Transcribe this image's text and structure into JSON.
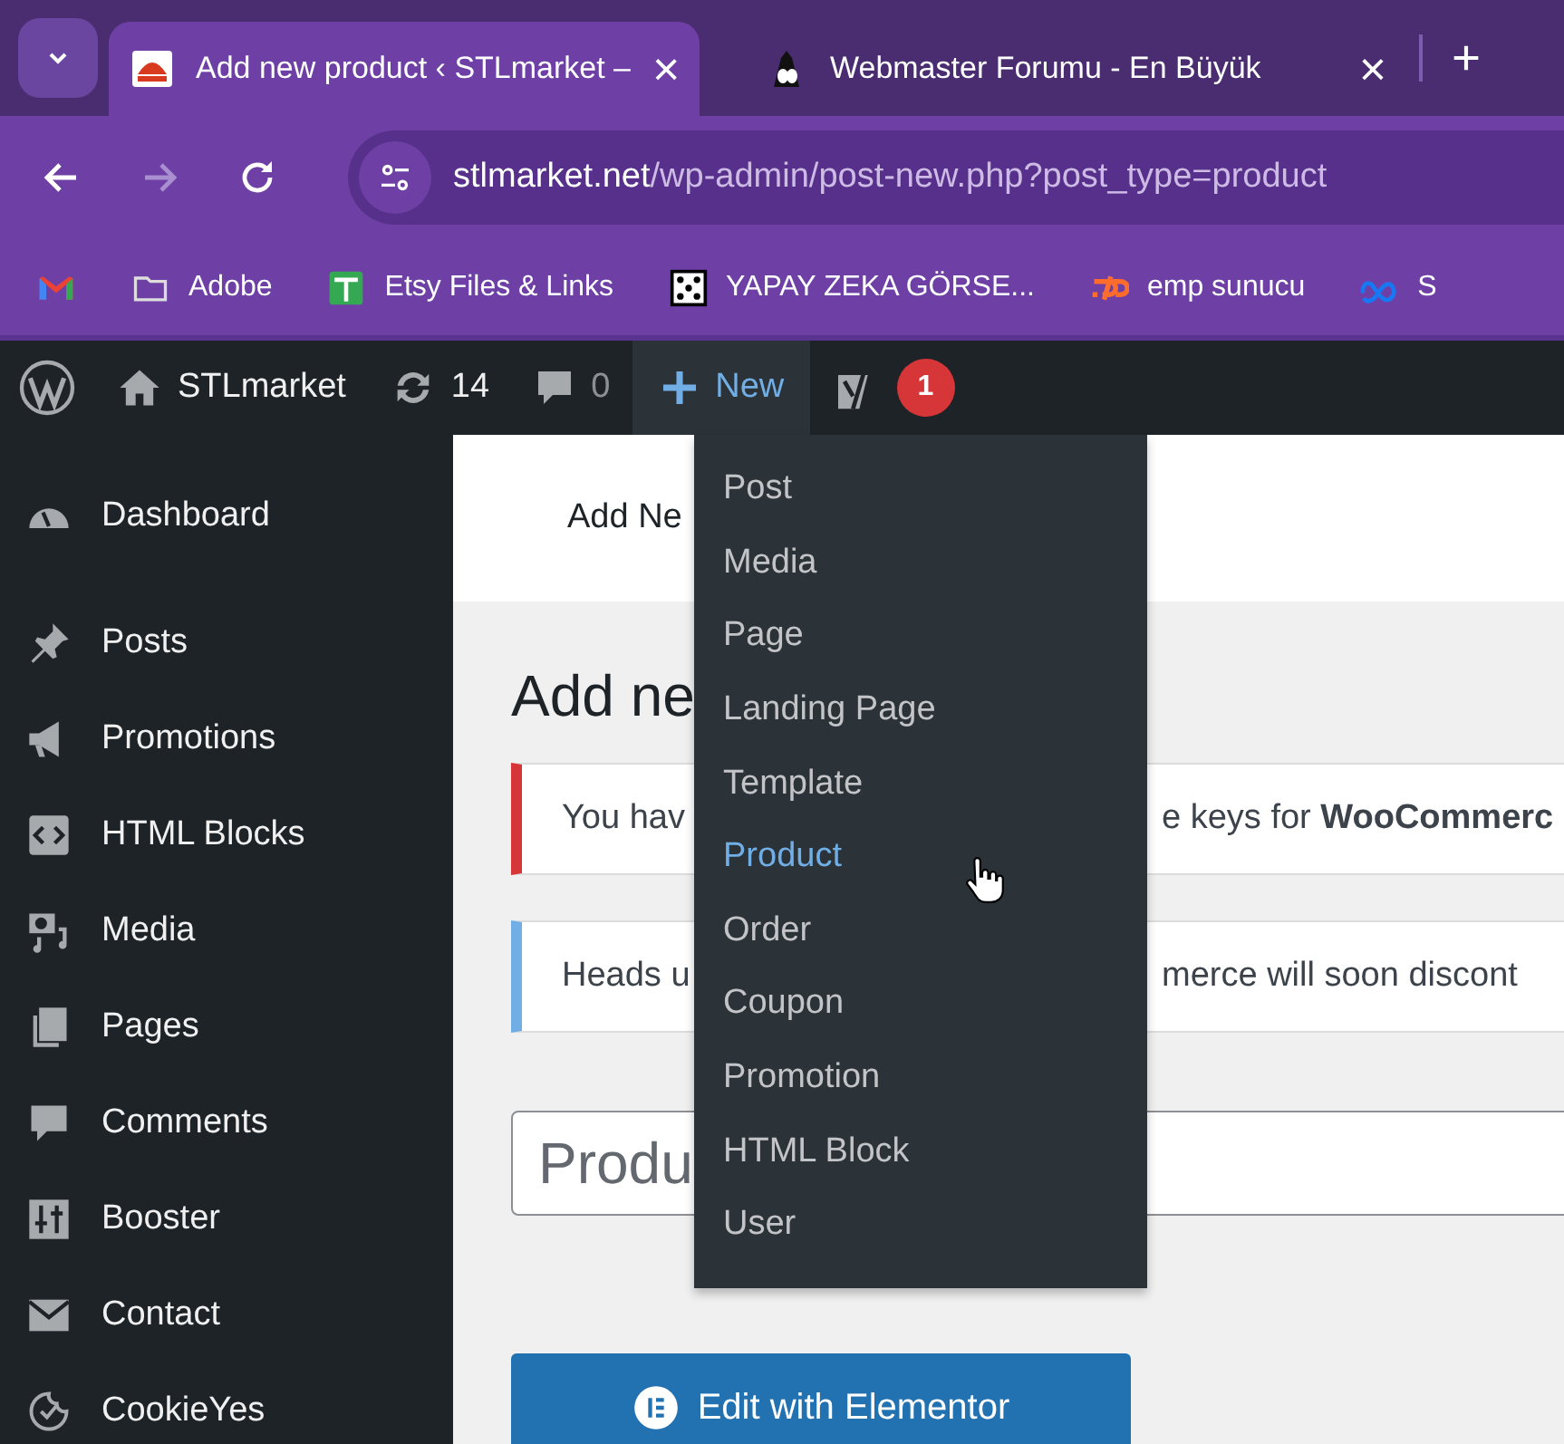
{
  "browser": {
    "tabs": [
      {
        "title": "Add new product ‹ STLmarket –",
        "close": "×",
        "selected": true
      },
      {
        "title": "Webmaster Forumu - En Büyük",
        "close": "×",
        "selected": false
      }
    ],
    "forward_disabled": true,
    "url_host": "stlmarket.net",
    "url_path": "/wp-admin/post-new.php?post_type=product",
    "bookmarks": [
      {
        "kind": "gmail"
      },
      {
        "kind": "folder",
        "label": "Adobe"
      },
      {
        "kind": "sheet",
        "label": "Etsy Files & Links"
      },
      {
        "kind": "dice",
        "label": "YAPAY ZEKA GÖRSE..."
      },
      {
        "kind": "cpanel",
        "label": "emp sunucu"
      },
      {
        "kind": "meta",
        "label": "S"
      }
    ]
  },
  "admin_bar": {
    "site": "STLmarket",
    "updates": "14",
    "comments": "0",
    "new": "New",
    "yoast_badge": "1"
  },
  "new_menu": [
    {
      "label": "Post",
      "selected": false
    },
    {
      "label": "Media",
      "selected": false
    },
    {
      "label": "Page",
      "selected": false
    },
    {
      "label": "Landing Page",
      "selected": false
    },
    {
      "label": "Template",
      "selected": false
    },
    {
      "label": "Product",
      "selected": true
    },
    {
      "label": "Order",
      "selected": false
    },
    {
      "label": "Coupon",
      "selected": false
    },
    {
      "label": "Promotion",
      "selected": false
    },
    {
      "label": "HTML Block",
      "selected": false
    },
    {
      "label": "User",
      "selected": false
    }
  ],
  "sidebar": {
    "items": [
      {
        "kind": "dashboard",
        "label": "Dashboard"
      },
      {
        "kind": "pin",
        "label": "Posts"
      },
      {
        "kind": "megaphone",
        "label": "Promotions"
      },
      {
        "kind": "code",
        "label": "HTML Blocks"
      },
      {
        "kind": "media",
        "label": "Media"
      },
      {
        "kind": "pages",
        "label": "Pages"
      },
      {
        "kind": "comment",
        "label": "Comments"
      },
      {
        "kind": "sliders",
        "label": "Booster"
      },
      {
        "kind": "mail",
        "label": "Contact"
      },
      {
        "kind": "cookie",
        "label": "CookieYes"
      }
    ]
  },
  "content": {
    "header_tab": "Add Ne",
    "title": "Add ne",
    "notices": [
      {
        "kind": "error",
        "left": "You hav",
        "right": "e keys for **WooCommerc**"
      },
      {
        "kind": "info",
        "left": "Heads u",
        "right": "merce will soon discont"
      }
    ],
    "title_placeholder": "Produ",
    "elementor_button": "Edit with Elementor"
  }
}
